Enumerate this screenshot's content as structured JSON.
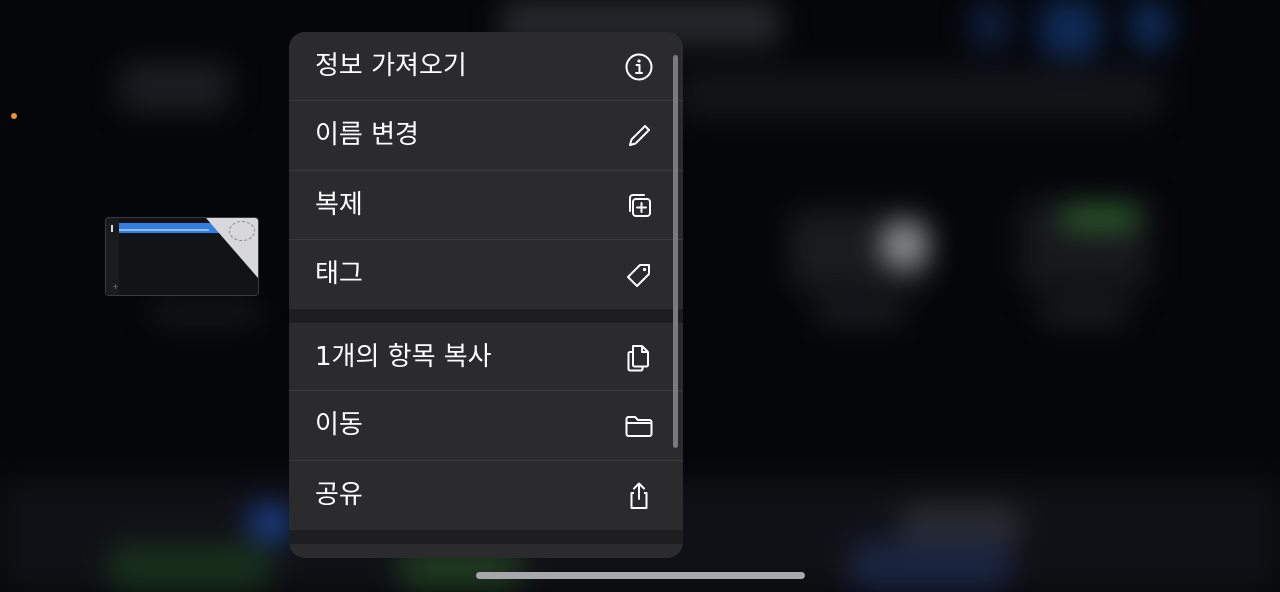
{
  "menu": {
    "items": [
      {
        "label": "정보 가져오기",
        "icon": "info-icon"
      },
      {
        "label": "이름 변경",
        "icon": "pencil-icon"
      },
      {
        "label": "복제",
        "icon": "duplicate-icon"
      },
      {
        "label": "태그",
        "icon": "tag-icon"
      },
      {
        "label": "1개의 항목 복사",
        "icon": "copy-document-icon"
      },
      {
        "label": "이동",
        "icon": "folder-icon"
      },
      {
        "label": "공유",
        "icon": "share-icon"
      }
    ]
  },
  "colors": {
    "menu_background": "#2b2b2e",
    "menu_text": "#ffffff",
    "status_dot": "#f0952a",
    "thumbnail_highlight": "#2f7fe0"
  }
}
